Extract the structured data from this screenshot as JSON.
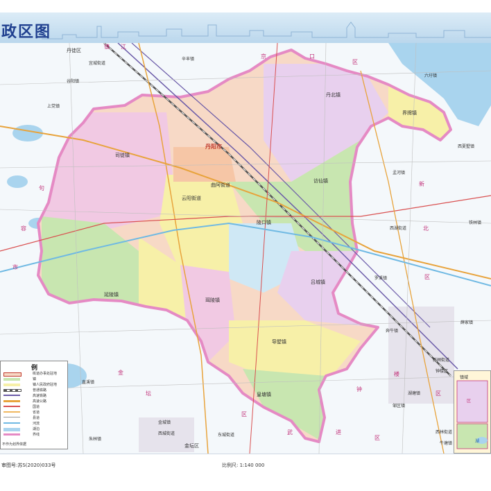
{
  "map": {
    "title": "政区图",
    "approval_number": "审图号:苏S(2020)033号",
    "scale": "比例尺: 1:140 000",
    "legend_title": "例",
    "legend_items": [
      "街道办事处驻地",
      "镇",
      "镇人民政府驻地",
      "普通铁路",
      "高速铁路",
      "高速公路",
      "国道",
      "省道",
      "县道",
      "河流",
      "湖泊",
      "界线"
    ],
    "legend_note": "不作为划界依据",
    "towns": [
      {
        "name": "丹阳市",
        "id": "city-seat"
      },
      {
        "name": "丹北镇",
        "id": "danbei"
      },
      {
        "name": "界牌镇",
        "id": "jiepai"
      },
      {
        "name": "访仙镇",
        "id": "fangxian"
      },
      {
        "name": "司徒镇",
        "id": "situ"
      },
      {
        "name": "云阳街道",
        "id": "yunyang"
      },
      {
        "name": "曲阿街道",
        "id": "qua"
      },
      {
        "name": "陵口镇",
        "id": "lingkou"
      },
      {
        "name": "延陵镇",
        "id": "yanling"
      },
      {
        "name": "珥陵镇",
        "id": "erling"
      },
      {
        "name": "吕城镇",
        "id": "lucheng"
      },
      {
        "name": "导墅镇",
        "id": "daoshu"
      },
      {
        "name": "皇塘镇",
        "id": "huangtang"
      }
    ],
    "outside_places": [
      {
        "name": "丹徒区",
        "id": "dantu"
      },
      {
        "name": "宜城街道",
        "id": "yicheng"
      },
      {
        "name": "谷阳镇",
        "id": "guyang"
      },
      {
        "name": "上党镇",
        "id": "shangdang"
      },
      {
        "name": "辛丰镇",
        "id": "xinfeng"
      },
      {
        "name": "六圩镇",
        "id": "liuwei"
      },
      {
        "name": "西夏墅镇",
        "id": "xixiashu"
      },
      {
        "name": "孟河镇",
        "id": "menghe"
      },
      {
        "name": "西湖街道",
        "id": "xihu-n"
      },
      {
        "name": "罗溪镇",
        "id": "luoxi"
      },
      {
        "name": "薛家镇",
        "id": "xuejia"
      },
      {
        "name": "奔牛镇",
        "id": "benniu"
      },
      {
        "name": "新闸街道",
        "id": "xinzha"
      },
      {
        "name": "钟楼区",
        "id": "zhonglou"
      },
      {
        "name": "邹区镇",
        "id": "zouqu"
      },
      {
        "name": "西林街道",
        "id": "xilin"
      },
      {
        "name": "牛塘镇",
        "id": "niutang"
      },
      {
        "name": "金坛区",
        "id": "jintan"
      },
      {
        "name": "金城镇",
        "id": "jincheng"
      },
      {
        "name": "西城街道",
        "id": "xicheng"
      },
      {
        "name": "东城街道",
        "id": "dongcheng"
      },
      {
        "name": "朱林镇",
        "id": "zhulin"
      },
      {
        "name": "直溪镇",
        "id": "zhixi"
      },
      {
        "name": "湖塘镇",
        "id": "hutang"
      },
      {
        "name": "铁林镇",
        "id": "tielin"
      }
    ],
    "district_words": [
      "京",
      "口",
      "区",
      "新",
      "北",
      "区",
      "钟",
      "楼",
      "区",
      "武",
      "进",
      "区",
      "金",
      "坛",
      "区",
      "句",
      "容",
      "市",
      "镇",
      "江"
    ],
    "inset_labels": [
      "镇域",
      "区",
      "湖"
    ]
  }
}
